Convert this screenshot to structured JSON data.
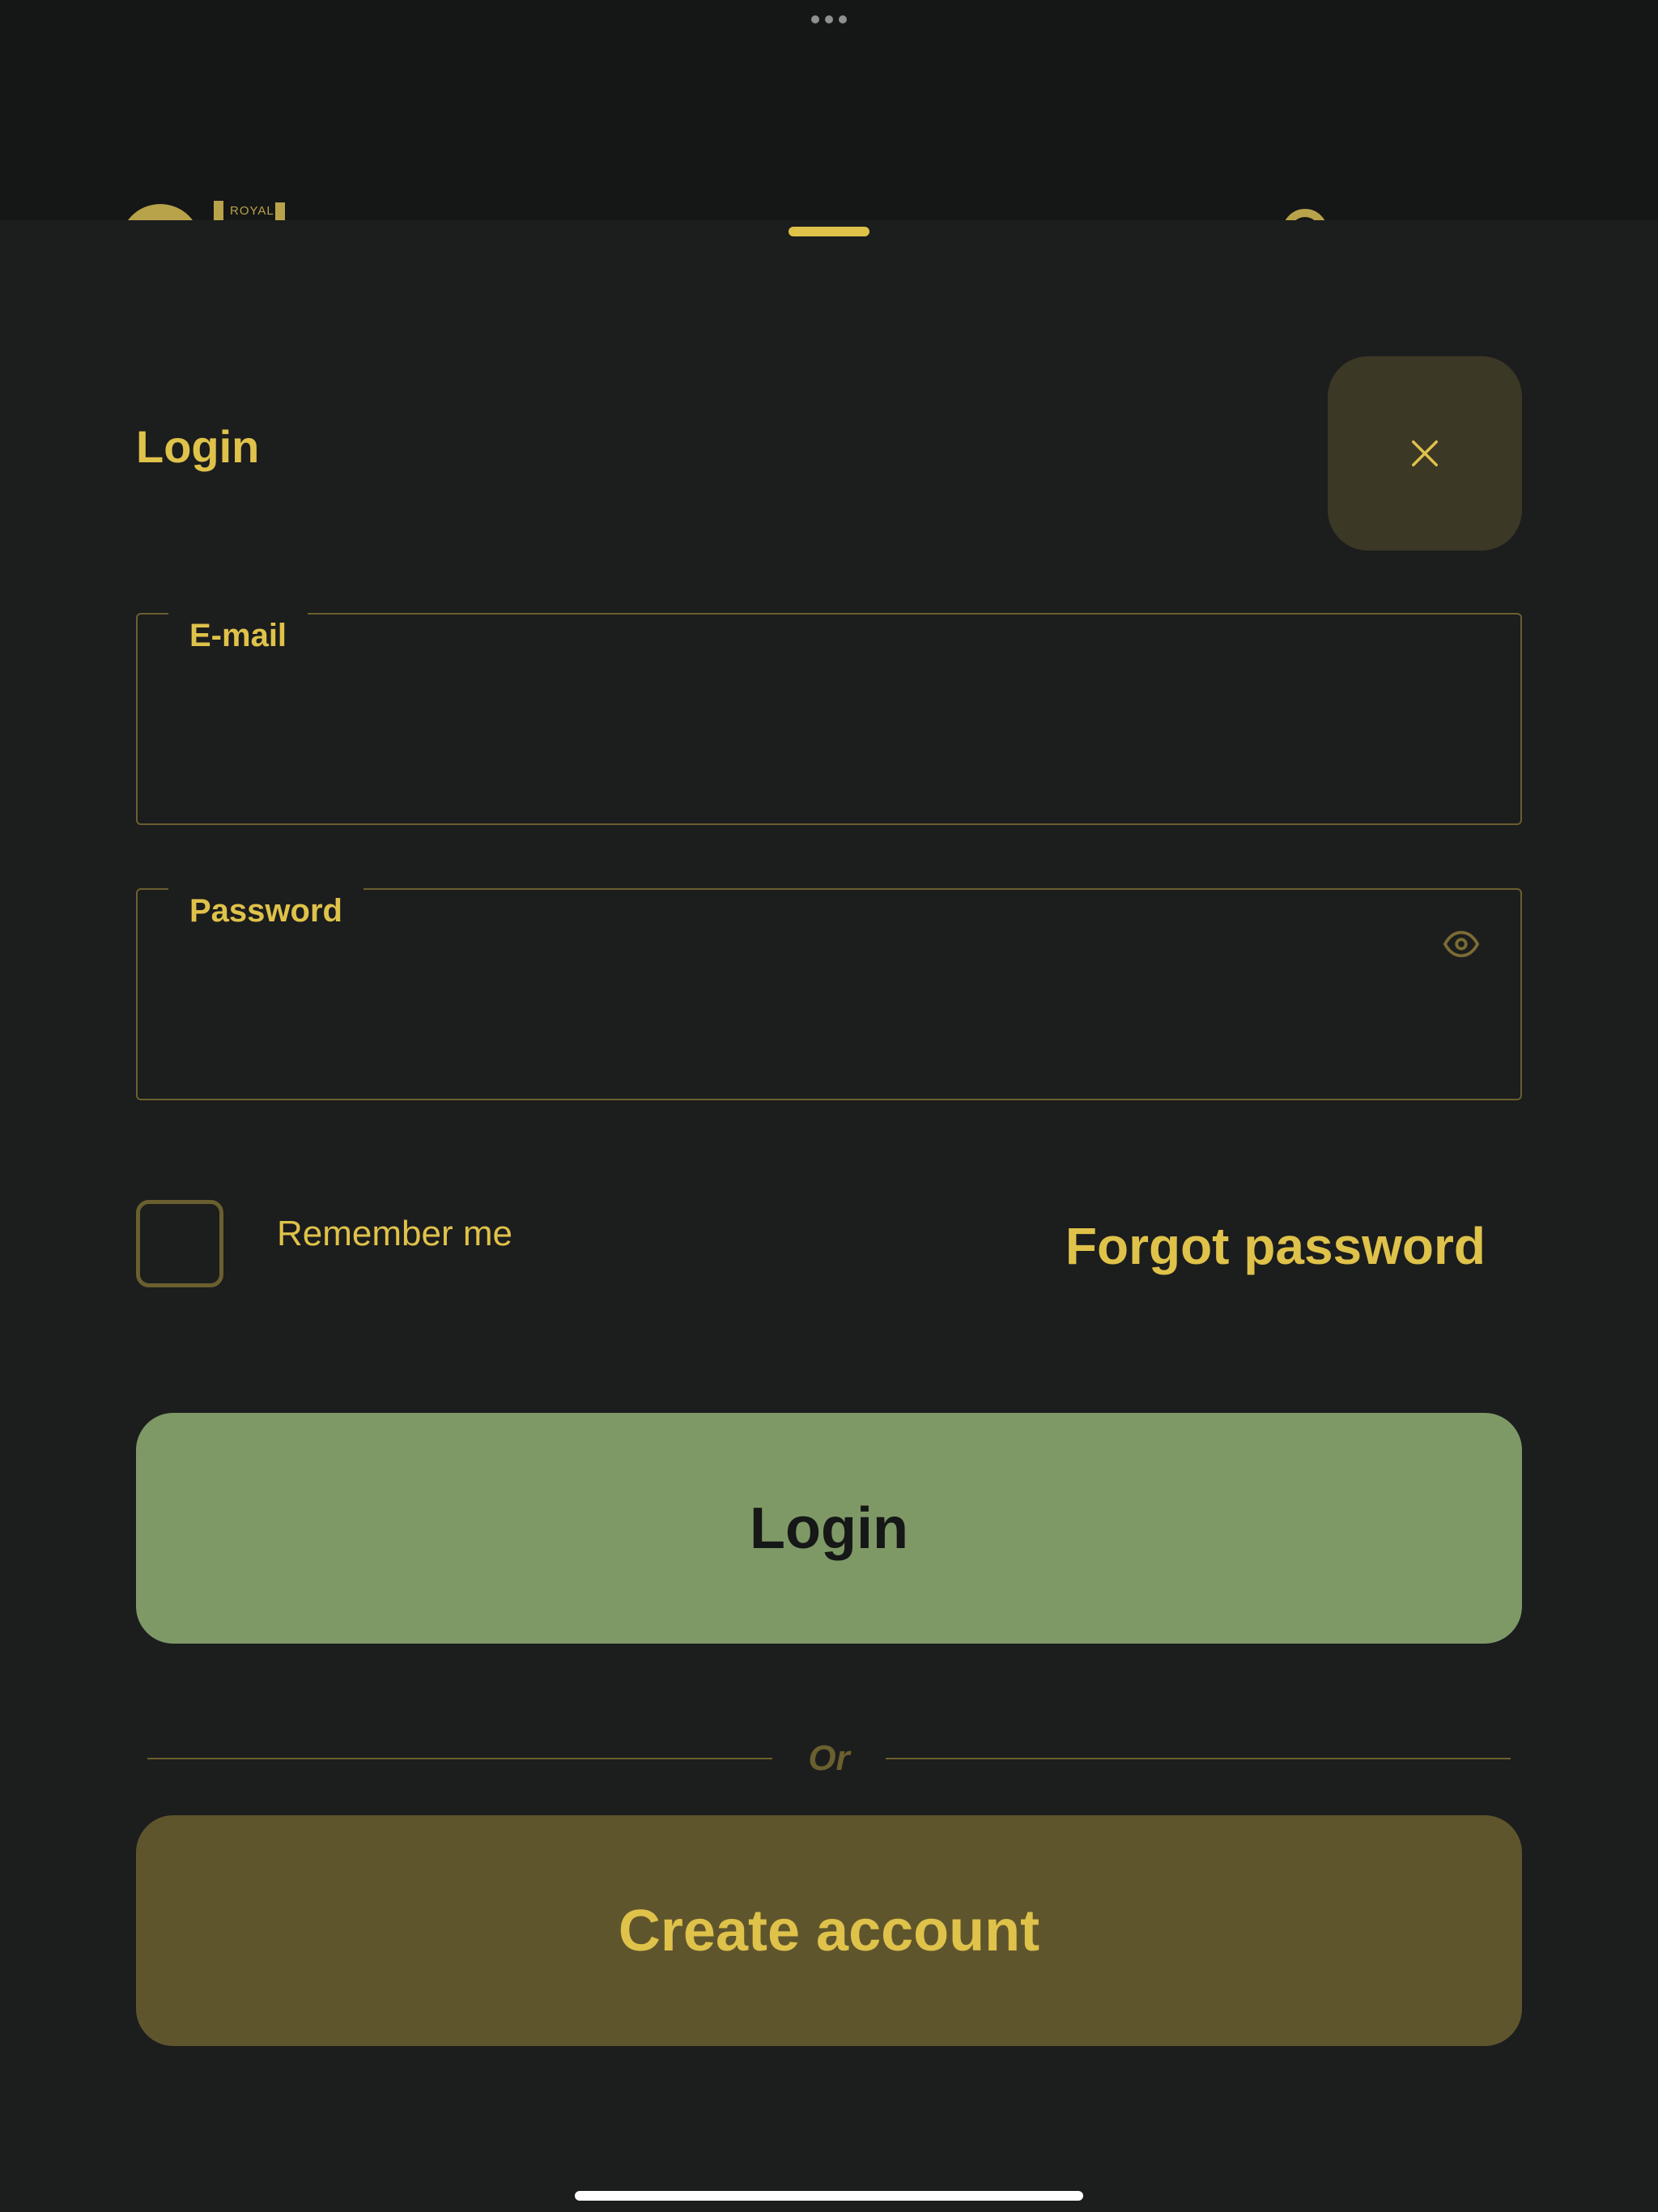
{
  "background": {
    "brand_text": "ROYAL"
  },
  "sheet": {
    "title": "Login",
    "close_icon": "close-icon"
  },
  "form": {
    "email": {
      "label": "E-mail",
      "value": "",
      "placeholder": ""
    },
    "password": {
      "label": "Password",
      "value": "",
      "placeholder": "",
      "toggle_icon": "eye-icon"
    },
    "remember": {
      "label": "Remember me",
      "checked": false
    },
    "forgot_label": "Forgot password"
  },
  "actions": {
    "login_label": "Login",
    "divider_text": "Or",
    "create_label": "Create account"
  },
  "colors": {
    "accent": "#dfc24a",
    "sheet_bg": "#1c1d1d",
    "login_bg": "#7e9966",
    "create_bg": "#5f552d",
    "close_bg": "#3c3826",
    "border": "#6a5f2f"
  }
}
